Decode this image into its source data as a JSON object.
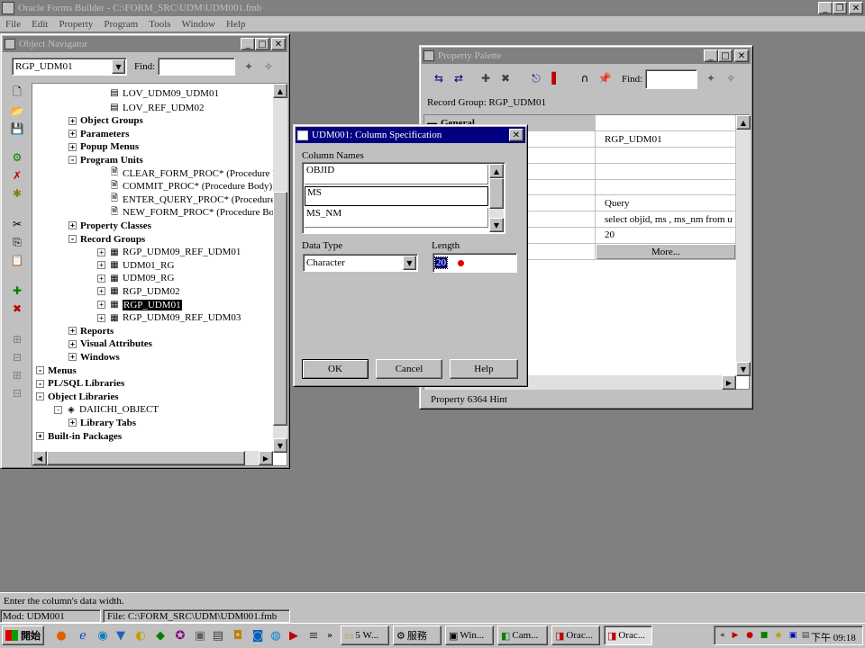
{
  "app": {
    "title": "Oracle Forms Builder - C:\\FORM_SRC\\UDM\\UDM001.fmb",
    "menu": [
      "File",
      "Edit",
      "Property",
      "Program",
      "Tools",
      "Window",
      "Help"
    ]
  },
  "navigator": {
    "title": "Object Navigator",
    "module_select": "RGP_UDM01",
    "find_label": "Find:",
    "find_value": "",
    "nodes": [
      {
        "label": "LOV_UDM09_UDM01",
        "bold": false,
        "indent": 3,
        "expander": "",
        "icon": "lov-icon"
      },
      {
        "label": "LOV_REF_UDM02",
        "bold": false,
        "indent": 3,
        "expander": "",
        "icon": "lov-icon"
      },
      {
        "label": "Object Groups",
        "bold": true,
        "indent": 2,
        "expander": "+",
        "icon": ""
      },
      {
        "label": "Parameters",
        "bold": true,
        "indent": 2,
        "expander": "+",
        "icon": ""
      },
      {
        "label": "Popup Menus",
        "bold": true,
        "indent": 2,
        "expander": "+",
        "icon": ""
      },
      {
        "label": "Program Units",
        "bold": true,
        "indent": 2,
        "expander": "-",
        "icon": ""
      },
      {
        "label": "CLEAR_FORM_PROC* (Procedure Bo",
        "bold": false,
        "indent": 3,
        "expander": "",
        "icon": "procedure-icon"
      },
      {
        "label": "COMMIT_PROC* (Procedure Body)",
        "bold": false,
        "indent": 3,
        "expander": "",
        "icon": "procedure-icon"
      },
      {
        "label": "ENTER_QUERY_PROC* (Procedure Bo",
        "bold": false,
        "indent": 3,
        "expander": "",
        "icon": "procedure-icon"
      },
      {
        "label": "NEW_FORM_PROC* (Procedure Body",
        "bold": false,
        "indent": 3,
        "expander": "",
        "icon": "procedure-icon"
      },
      {
        "label": "Property Classes",
        "bold": true,
        "indent": 2,
        "expander": "+",
        "icon": ""
      },
      {
        "label": "Record Groups",
        "bold": true,
        "indent": 2,
        "expander": "-",
        "icon": ""
      },
      {
        "label": "RGP_UDM09_REF_UDM01",
        "bold": false,
        "indent": 3,
        "expander": "+",
        "icon": "record-group-icon"
      },
      {
        "label": "UDM01_RG",
        "bold": false,
        "indent": 3,
        "expander": "+",
        "icon": "record-group-icon"
      },
      {
        "label": "UDM09_RG",
        "bold": false,
        "indent": 3,
        "expander": "+",
        "icon": "record-group-icon"
      },
      {
        "label": "RGP_UDM02",
        "bold": false,
        "indent": 3,
        "expander": "+",
        "icon": "record-group-icon"
      },
      {
        "label": "RGP_UDM01",
        "bold": false,
        "indent": 3,
        "expander": "+",
        "icon": "record-group-icon",
        "selected": true
      },
      {
        "label": "RGP_UDM09_REF_UDM03",
        "bold": false,
        "indent": 3,
        "expander": "+",
        "icon": "record-group-icon"
      },
      {
        "label": "Reports",
        "bold": true,
        "indent": 2,
        "expander": "+",
        "icon": ""
      },
      {
        "label": "Visual Attributes",
        "bold": true,
        "indent": 2,
        "expander": "+",
        "icon": ""
      },
      {
        "label": "Windows",
        "bold": true,
        "indent": 2,
        "expander": "+",
        "icon": ""
      },
      {
        "label": "Menus",
        "bold": true,
        "indent": 0,
        "expander": "-",
        "icon": ""
      },
      {
        "label": "PL/SQL Libraries",
        "bold": true,
        "indent": 0,
        "expander": "-",
        "icon": ""
      },
      {
        "label": "Object Libraries",
        "bold": true,
        "indent": 0,
        "expander": "-",
        "icon": ""
      },
      {
        "label": "DAIICHI_OBJECT",
        "bold": false,
        "indent": 1,
        "expander": "-",
        "icon": "object-library-icon"
      },
      {
        "label": "Library Tabs",
        "bold": true,
        "indent": 2,
        "expander": "+",
        "icon": ""
      },
      {
        "label": "Built-in Packages",
        "bold": true,
        "indent": 0,
        "expander": "+",
        "icon": ""
      }
    ]
  },
  "palette": {
    "title": "Property Palette",
    "find_label": "Find:",
    "find_value": "",
    "header": "Record Group: RGP_UDM01",
    "section": "General",
    "rows": [
      {
        "name": "",
        "value": "RGP_UDM01"
      },
      {
        "name": "n",
        "value": ""
      },
      {
        "name": "",
        "value": ""
      },
      {
        "name": "",
        "value": ""
      },
      {
        "name": "e",
        "value": "Query"
      },
      {
        "name": "y",
        "value": "select objid, ms , ms_nm    from u"
      },
      {
        "name": "n Size",
        "value": "20"
      },
      {
        "name": "ons",
        "value": "More..."
      }
    ],
    "hint": "Property 6364 Hint"
  },
  "dialog": {
    "title": "UDM001: Column Specification",
    "column_names_label": "Column Names",
    "columns": [
      "OBJID",
      "MS",
      "MS_NM"
    ],
    "data_type_label": "Data Type",
    "data_type_value": "Character",
    "length_label": "Length",
    "length_value": "20",
    "ok_label": "OK",
    "cancel_label": "Cancel",
    "help_label": "Help"
  },
  "status": {
    "message": "Enter the column's data width.",
    "mod": "Mod: UDM001",
    "file": "File: C:\\FORM_SRC\\UDM\\UDM001.fmb"
  },
  "taskbar": {
    "start_label": "開始",
    "tasks": [
      "5 W...",
      "服務",
      "Win...",
      "Cam...",
      "Orac...",
      "Orac..."
    ],
    "clock": "下午 09:18"
  },
  "colors": {
    "desktop": "#808080",
    "active_title": "#000080",
    "inactive_title": "#808080",
    "face": "#c0c0c0"
  }
}
